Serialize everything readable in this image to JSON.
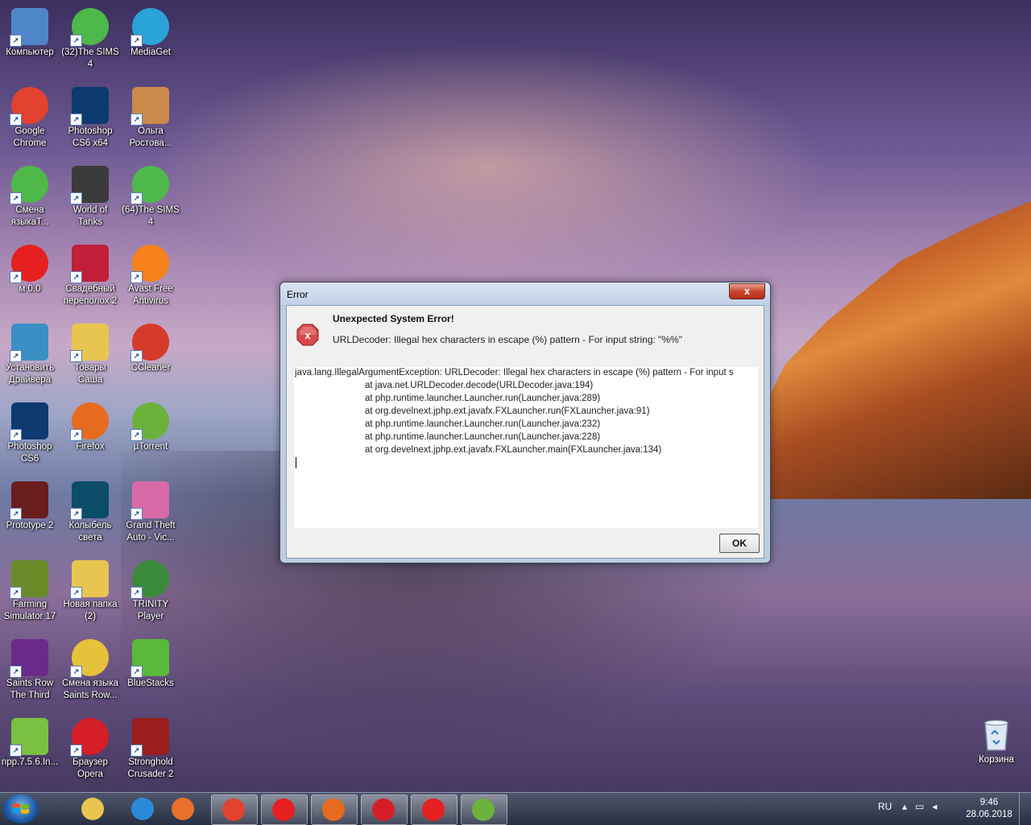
{
  "desktop": {
    "icons": [
      {
        "label": "Компьютер",
        "icon": "computer-icon",
        "color": "#4f86c9"
      },
      {
        "label": "(32)The SIMS 4",
        "icon": "sims-icon",
        "color": "#4fb84a"
      },
      {
        "label": "MediaGet",
        "icon": "mediaget-icon",
        "color": "#2aa3d8"
      },
      {
        "label": "Google Chrome",
        "icon": "chrome-icon",
        "color": "#e3422f"
      },
      {
        "label": "Photoshop CS6 x64",
        "icon": "photoshop-icon",
        "color": "#0d3a70"
      },
      {
        "label": "Ольга Ростова...",
        "icon": "cowgirl-icon",
        "color": "#c98a4a"
      },
      {
        "label": "Смена языкаТ...",
        "icon": "sims-icon",
        "color": "#4fb84a"
      },
      {
        "label": "World of Tanks",
        "icon": "wot-icon",
        "color": "#3b3b3b"
      },
      {
        "label": "(64)The SIMS 4",
        "icon": "sims-icon",
        "color": "#4fb84a"
      },
      {
        "label": "м 0.0",
        "icon": "yandex-icon",
        "color": "#e62020"
      },
      {
        "label": "Свадебный переполох 2",
        "icon": "wedding-game-icon",
        "color": "#c21f3a"
      },
      {
        "label": "Avast Free Antivirus",
        "icon": "avast-icon",
        "color": "#f7821b"
      },
      {
        "label": "Установить Драйвера",
        "icon": "driver-install-icon",
        "color": "#3a8fc4"
      },
      {
        "label": "Товары Саша",
        "icon": "folder-icon",
        "color": "#e8c451"
      },
      {
        "label": "CCleaner",
        "icon": "ccleaner-icon",
        "color": "#d53a2a"
      },
      {
        "label": "Photoshop CS6",
        "icon": "photoshop-icon",
        "color": "#0d3a70"
      },
      {
        "label": "Firefox",
        "icon": "firefox-icon",
        "color": "#e66b1f"
      },
      {
        "label": "µTorrent",
        "icon": "utorrent-icon",
        "color": "#6bb13b"
      },
      {
        "label": "Prototype 2",
        "icon": "prototype-icon",
        "color": "#6a1d1d"
      },
      {
        "label": "Колыбель света",
        "icon": "cradle-icon",
        "color": "#0c4d6a"
      },
      {
        "label": "Grand Theft Auto - Vic...",
        "icon": "gta-icon",
        "color": "#d86aa8"
      },
      {
        "label": "Farming Simulator 17",
        "icon": "farming-icon",
        "color": "#6a8a2a"
      },
      {
        "label": "Новая папка (2)",
        "icon": "folder-icon",
        "color": "#e8c451"
      },
      {
        "label": "TRINITY Player",
        "icon": "trinity-player-icon",
        "color": "#3a8a3a"
      },
      {
        "label": "Saints Row The Third",
        "icon": "saints-row-icon",
        "color": "#6a2a8a"
      },
      {
        "label": "Смена языка Saints Row...",
        "icon": "disc-icon",
        "color": "#e6c23a"
      },
      {
        "label": "BlueStacks",
        "icon": "bluestacks-icon",
        "color": "#5ab83a"
      },
      {
        "label": "npp.7.5.6.In...",
        "icon": "notepadpp-icon",
        "color": "#7ac043"
      },
      {
        "label": "Браузер Opera",
        "icon": "opera-icon",
        "color": "#d61e28"
      },
      {
        "label": "Stronghold Crusader 2",
        "icon": "stronghold-icon",
        "color": "#9a1e1e"
      }
    ],
    "recycle_bin": {
      "label": "Корзина",
      "icon": "recycle-bin-icon"
    }
  },
  "dialog": {
    "title": "Error",
    "close_label": "x",
    "heading": "Unexpected System Error!",
    "message": "URLDecoder: Illegal hex characters in escape (%) pattern - For input string: \"%%\"",
    "trace": [
      "java.lang.IllegalArgumentException: URLDecoder: Illegal hex characters in escape (%) pattern - For input s",
      "at java.net.URLDecoder.decode(URLDecoder.java:194)",
      "at php.runtime.launcher.Launcher.run(Launcher.java:289)",
      "at org.develnext.jphp.ext.javafx.FXLauncher.run(FXLauncher.java:91)",
      "at php.runtime.launcher.Launcher.run(Launcher.java:232)",
      "at php.runtime.launcher.Launcher.run(Launcher.java:228)",
      "at org.develnext.jphp.ext.javafx.FXLauncher.main(FXLauncher.java:134)"
    ],
    "ok_label": "OK"
  },
  "taskbar": {
    "buttons": [
      {
        "icon": "explorer-icon",
        "color": "#e8c451"
      },
      {
        "icon": "ie-icon",
        "color": "#2a8ad8"
      },
      {
        "icon": "media-player-icon",
        "color": "#e8702a"
      },
      {
        "icon": "chrome-icon",
        "color": "#e3422f"
      },
      {
        "icon": "yandex-icon",
        "color": "#e62020"
      },
      {
        "icon": "firefox-icon",
        "color": "#e66b1f"
      },
      {
        "icon": "opera-icon",
        "color": "#d61e28"
      },
      {
        "icon": "yandex-browser-icon",
        "color": "#e62020"
      },
      {
        "icon": "utorrent-icon",
        "color": "#6bb13b"
      }
    ],
    "language": "RU",
    "time": "9:46",
    "date": "28.06.2018"
  }
}
